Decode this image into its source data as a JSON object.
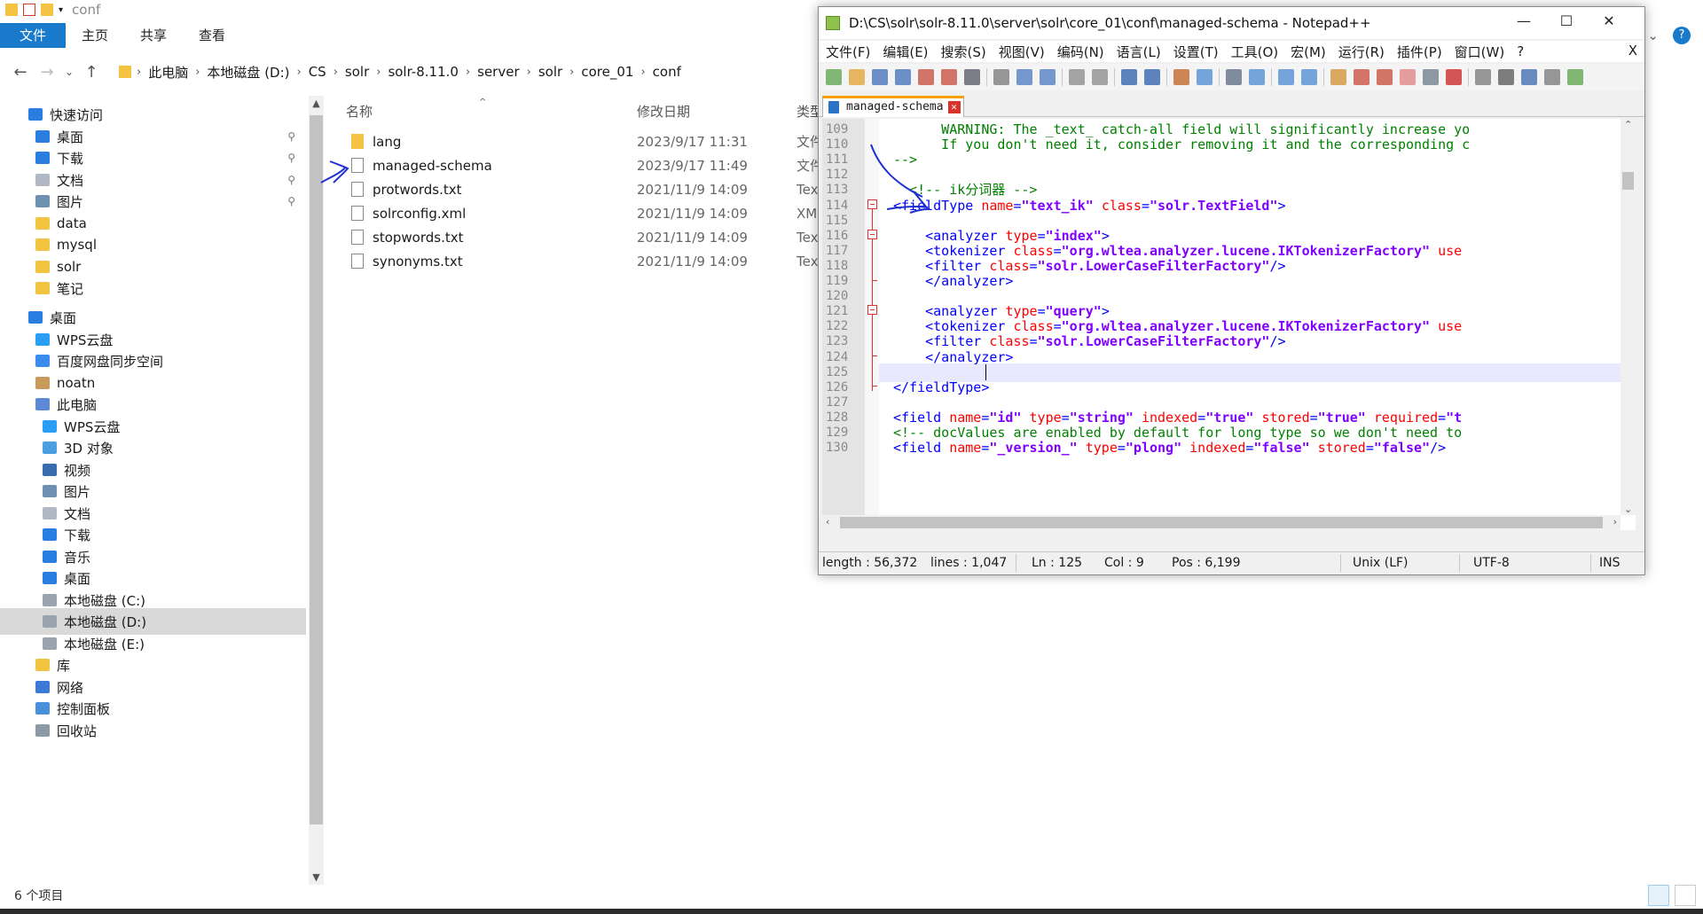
{
  "explorer": {
    "title": "conf",
    "ribbon_tabs": [
      "文件",
      "主页",
      "共享",
      "查看"
    ],
    "breadcrumbs": [
      "此电脑",
      "本地磁盘 (D:)",
      "CS",
      "solr",
      "solr-8.11.0",
      "server",
      "solr",
      "core_01",
      "conf"
    ],
    "sidebar": [
      {
        "label": "快速访问",
        "icon": "star-icon",
        "pinned": false
      },
      {
        "label": "桌面",
        "icon": "desktop-icon",
        "pinned": true
      },
      {
        "label": "下载",
        "icon": "download-icon",
        "pinned": true
      },
      {
        "label": "文档",
        "icon": "document-icon",
        "pinned": true
      },
      {
        "label": "图片",
        "icon": "picture-icon",
        "pinned": true
      },
      {
        "label": "data",
        "icon": "folder-icon",
        "pinned": false
      },
      {
        "label": "mysql",
        "icon": "folder-icon",
        "pinned": false
      },
      {
        "label": "solr",
        "icon": "folder-icon",
        "pinned": false
      },
      {
        "label": "笔记",
        "icon": "folder-icon",
        "pinned": false
      },
      {
        "label": "桌面",
        "icon": "desktop-icon",
        "pinned": false
      },
      {
        "label": "WPS云盘",
        "icon": "cloud-icon",
        "pinned": false
      },
      {
        "label": "百度网盘同步空间",
        "icon": "baidu-icon",
        "pinned": false
      },
      {
        "label": "noatn",
        "icon": "user-icon",
        "pinned": false
      },
      {
        "label": "此电脑",
        "icon": "computer-icon",
        "pinned": false
      },
      {
        "label": "WPS云盘",
        "icon": "cloud-icon",
        "pinned": false
      },
      {
        "label": "3D 对象",
        "icon": "cube-icon",
        "pinned": false
      },
      {
        "label": "视频",
        "icon": "video-icon",
        "pinned": false
      },
      {
        "label": "图片",
        "icon": "picture-icon",
        "pinned": false
      },
      {
        "label": "文档",
        "icon": "document-icon",
        "pinned": false
      },
      {
        "label": "下载",
        "icon": "download-icon",
        "pinned": false
      },
      {
        "label": "音乐",
        "icon": "music-icon",
        "pinned": false
      },
      {
        "label": "桌面",
        "icon": "desktop-icon",
        "pinned": false
      },
      {
        "label": "本地磁盘 (C:)",
        "icon": "drive-icon",
        "pinned": false
      },
      {
        "label": "本地磁盘 (D:)",
        "icon": "drive-icon",
        "pinned": false,
        "selected": true
      },
      {
        "label": "本地磁盘 (E:)",
        "icon": "drive-icon",
        "pinned": false
      },
      {
        "label": "库",
        "icon": "library-icon",
        "pinned": false
      },
      {
        "label": "网络",
        "icon": "network-icon",
        "pinned": false
      },
      {
        "label": "控制面板",
        "icon": "control-panel-icon",
        "pinned": false
      },
      {
        "label": "回收站",
        "icon": "recycle-bin-icon",
        "pinned": false
      }
    ],
    "columns": {
      "name": "名称",
      "date": "修改日期",
      "type": "类型"
    },
    "files": [
      {
        "name": "lang",
        "date": "2023/9/17 11:31",
        "type": "文件",
        "icon": "folder-icon"
      },
      {
        "name": "managed-schema",
        "date": "2023/9/17 11:49",
        "type": "文件",
        "icon": "file-icon"
      },
      {
        "name": "protwords.txt",
        "date": "2021/11/9 14:09",
        "type": "Tex",
        "icon": "text-file-icon"
      },
      {
        "name": "solrconfig.xml",
        "date": "2021/11/9 14:09",
        "type": "XM",
        "icon": "xml-file-icon"
      },
      {
        "name": "stopwords.txt",
        "date": "2021/11/9 14:09",
        "type": "Tex",
        "icon": "text-file-icon"
      },
      {
        "name": "synonyms.txt",
        "date": "2021/11/9 14:09",
        "type": "Tex",
        "icon": "text-file-icon"
      }
    ],
    "status": "6 个项目"
  },
  "notepad": {
    "title": "D:\\CS\\solr\\solr-8.11.0\\server\\solr\\core_01\\conf\\managed-schema - Notepad++",
    "menu": [
      "文件(F)",
      "编辑(E)",
      "搜索(S)",
      "视图(V)",
      "编码(N)",
      "语言(L)",
      "设置(T)",
      "工具(O)",
      "宏(M)",
      "运行(R)",
      "插件(P)",
      "窗口(W)",
      "?"
    ],
    "close_doc": "X",
    "tab_label": "managed-schema",
    "lines": [
      {
        "n": "109",
        "parts": [
          [
            "c-comment",
            "      WARNING: The _text_ catch-all field will significantly increase yo"
          ]
        ]
      },
      {
        "n": "110",
        "parts": [
          [
            "c-comment",
            "      If you don't need it, consider removing it and the corresponding c"
          ]
        ]
      },
      {
        "n": "111",
        "parts": [
          [
            "c-comment",
            "-->"
          ]
        ]
      },
      {
        "n": "112",
        "parts": []
      },
      {
        "n": "113",
        "parts": [
          [
            "c-comment",
            "  <!-- ik分词器 -->"
          ]
        ]
      },
      {
        "n": "114",
        "parts": [
          [
            "c-tag",
            "<fieldType"
          ],
          [
            "c-txt",
            " "
          ],
          [
            "c-attr",
            "name"
          ],
          [
            "c-punct",
            "="
          ],
          [
            "c-val",
            "\"text_ik\""
          ],
          [
            "c-txt",
            " "
          ],
          [
            "c-attr",
            "class"
          ],
          [
            "c-punct",
            "="
          ],
          [
            "c-val",
            "\"solr.TextField\""
          ],
          [
            "c-tag",
            ">"
          ]
        ]
      },
      {
        "n": "115",
        "parts": []
      },
      {
        "n": "116",
        "parts": [
          [
            "c-txt",
            "    "
          ],
          [
            "c-tag",
            "<analyzer"
          ],
          [
            "c-txt",
            " "
          ],
          [
            "c-attr",
            "type"
          ],
          [
            "c-punct",
            "="
          ],
          [
            "c-val",
            "\"index\""
          ],
          [
            "c-tag",
            ">"
          ]
        ]
      },
      {
        "n": "117",
        "parts": [
          [
            "c-txt",
            "    "
          ],
          [
            "c-tag",
            "<tokenizer"
          ],
          [
            "c-txt",
            " "
          ],
          [
            "c-attr",
            "class"
          ],
          [
            "c-punct",
            "="
          ],
          [
            "c-val",
            "\"org.wltea.analyzer.lucene.IKTokenizerFactory\""
          ],
          [
            "c-txt",
            " "
          ],
          [
            "c-attr",
            "use"
          ]
        ]
      },
      {
        "n": "118",
        "parts": [
          [
            "c-txt",
            "    "
          ],
          [
            "c-tag",
            "<filter"
          ],
          [
            "c-txt",
            " "
          ],
          [
            "c-attr",
            "class"
          ],
          [
            "c-punct",
            "="
          ],
          [
            "c-val",
            "\"solr.LowerCaseFilterFactory\""
          ],
          [
            "c-tag",
            "/>"
          ]
        ]
      },
      {
        "n": "119",
        "parts": [
          [
            "c-txt",
            "    "
          ],
          [
            "c-tag",
            "</analyzer>"
          ]
        ]
      },
      {
        "n": "120",
        "parts": []
      },
      {
        "n": "121",
        "parts": [
          [
            "c-txt",
            "    "
          ],
          [
            "c-tag",
            "<analyzer"
          ],
          [
            "c-txt",
            " "
          ],
          [
            "c-attr",
            "type"
          ],
          [
            "c-punct",
            "="
          ],
          [
            "c-val",
            "\"query\""
          ],
          [
            "c-tag",
            ">"
          ]
        ]
      },
      {
        "n": "122",
        "parts": [
          [
            "c-txt",
            "    "
          ],
          [
            "c-tag",
            "<tokenizer"
          ],
          [
            "c-txt",
            " "
          ],
          [
            "c-attr",
            "class"
          ],
          [
            "c-punct",
            "="
          ],
          [
            "c-val",
            "\"org.wltea.analyzer.lucene.IKTokenizerFactory\""
          ],
          [
            "c-txt",
            " "
          ],
          [
            "c-attr",
            "use"
          ]
        ]
      },
      {
        "n": "123",
        "parts": [
          [
            "c-txt",
            "    "
          ],
          [
            "c-tag",
            "<filter"
          ],
          [
            "c-txt",
            " "
          ],
          [
            "c-attr",
            "class"
          ],
          [
            "c-punct",
            "="
          ],
          [
            "c-val",
            "\"solr.LowerCaseFilterFactory\""
          ],
          [
            "c-tag",
            "/>"
          ]
        ]
      },
      {
        "n": "124",
        "parts": [
          [
            "c-txt",
            "    "
          ],
          [
            "c-tag",
            "</analyzer>"
          ]
        ]
      },
      {
        "n": "125",
        "parts": []
      },
      {
        "n": "126",
        "parts": [
          [
            "c-tag",
            "</fieldType>"
          ]
        ]
      },
      {
        "n": "127",
        "parts": []
      },
      {
        "n": "128",
        "parts": [
          [
            "c-tag",
            "<field"
          ],
          [
            "c-txt",
            " "
          ],
          [
            "c-attr",
            "name"
          ],
          [
            "c-punct",
            "="
          ],
          [
            "c-val",
            "\"id\""
          ],
          [
            "c-txt",
            " "
          ],
          [
            "c-attr",
            "type"
          ],
          [
            "c-punct",
            "="
          ],
          [
            "c-val",
            "\"string\""
          ],
          [
            "c-txt",
            " "
          ],
          [
            "c-attr",
            "indexed"
          ],
          [
            "c-punct",
            "="
          ],
          [
            "c-val",
            "\"true\""
          ],
          [
            "c-txt",
            " "
          ],
          [
            "c-attr",
            "stored"
          ],
          [
            "c-punct",
            "="
          ],
          [
            "c-val",
            "\"true\""
          ],
          [
            "c-txt",
            " "
          ],
          [
            "c-attr",
            "required"
          ],
          [
            "c-punct",
            "="
          ],
          [
            "c-val",
            "\"t"
          ]
        ]
      },
      {
        "n": "129",
        "parts": [
          [
            "c-comment",
            "<!-- docValues are enabled by default for long type so we don't need to"
          ]
        ]
      },
      {
        "n": "130",
        "parts": [
          [
            "c-tag",
            "<field"
          ],
          [
            "c-txt",
            " "
          ],
          [
            "c-attr",
            "name"
          ],
          [
            "c-punct",
            "="
          ],
          [
            "c-val",
            "\"_version_\""
          ],
          [
            "c-txt",
            " "
          ],
          [
            "c-attr",
            "type"
          ],
          [
            "c-punct",
            "="
          ],
          [
            "c-val",
            "\"plong\""
          ],
          [
            "c-txt",
            " "
          ],
          [
            "c-attr",
            "indexed"
          ],
          [
            "c-punct",
            "="
          ],
          [
            "c-val",
            "\"false\""
          ],
          [
            "c-txt",
            " "
          ],
          [
            "c-attr",
            "stored"
          ],
          [
            "c-punct",
            "="
          ],
          [
            "c-val",
            "\"false\""
          ],
          [
            "c-tag",
            "/>"
          ]
        ]
      }
    ],
    "status": {
      "length": "length : 56,372",
      "lines": "lines : 1,047",
      "ln": "Ln : 125",
      "col": "Col : 9",
      "pos": "Pos : 6,199",
      "eol": "Unix (LF)",
      "encoding": "UTF-8",
      "mode": "INS"
    }
  }
}
